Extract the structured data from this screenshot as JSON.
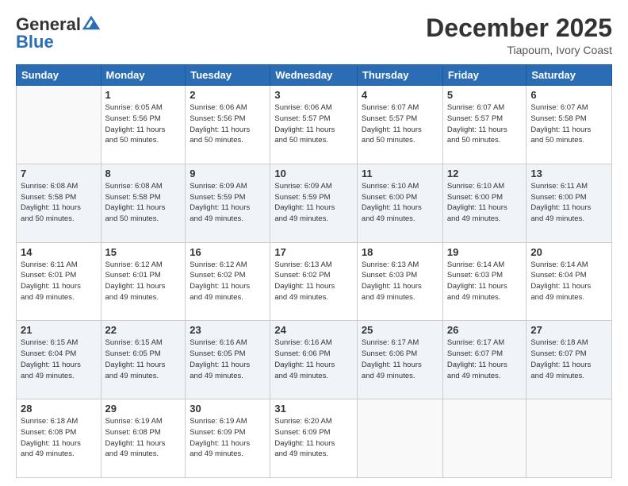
{
  "header": {
    "logo_general": "General",
    "logo_blue": "Blue",
    "month": "December 2025",
    "location": "Tiapoum, Ivory Coast"
  },
  "days_of_week": [
    "Sunday",
    "Monday",
    "Tuesday",
    "Wednesday",
    "Thursday",
    "Friday",
    "Saturday"
  ],
  "weeks": [
    [
      {
        "day": "",
        "info": ""
      },
      {
        "day": "1",
        "info": "Sunrise: 6:05 AM\nSunset: 5:56 PM\nDaylight: 11 hours\nand 50 minutes."
      },
      {
        "day": "2",
        "info": "Sunrise: 6:06 AM\nSunset: 5:56 PM\nDaylight: 11 hours\nand 50 minutes."
      },
      {
        "day": "3",
        "info": "Sunrise: 6:06 AM\nSunset: 5:57 PM\nDaylight: 11 hours\nand 50 minutes."
      },
      {
        "day": "4",
        "info": "Sunrise: 6:07 AM\nSunset: 5:57 PM\nDaylight: 11 hours\nand 50 minutes."
      },
      {
        "day": "5",
        "info": "Sunrise: 6:07 AM\nSunset: 5:57 PM\nDaylight: 11 hours\nand 50 minutes."
      },
      {
        "day": "6",
        "info": "Sunrise: 6:07 AM\nSunset: 5:58 PM\nDaylight: 11 hours\nand 50 minutes."
      }
    ],
    [
      {
        "day": "7",
        "info": "Sunrise: 6:08 AM\nSunset: 5:58 PM\nDaylight: 11 hours\nand 50 minutes."
      },
      {
        "day": "8",
        "info": "Sunrise: 6:08 AM\nSunset: 5:58 PM\nDaylight: 11 hours\nand 50 minutes."
      },
      {
        "day": "9",
        "info": "Sunrise: 6:09 AM\nSunset: 5:59 PM\nDaylight: 11 hours\nand 49 minutes."
      },
      {
        "day": "10",
        "info": "Sunrise: 6:09 AM\nSunset: 5:59 PM\nDaylight: 11 hours\nand 49 minutes."
      },
      {
        "day": "11",
        "info": "Sunrise: 6:10 AM\nSunset: 6:00 PM\nDaylight: 11 hours\nand 49 minutes."
      },
      {
        "day": "12",
        "info": "Sunrise: 6:10 AM\nSunset: 6:00 PM\nDaylight: 11 hours\nand 49 minutes."
      },
      {
        "day": "13",
        "info": "Sunrise: 6:11 AM\nSunset: 6:00 PM\nDaylight: 11 hours\nand 49 minutes."
      }
    ],
    [
      {
        "day": "14",
        "info": "Sunrise: 6:11 AM\nSunset: 6:01 PM\nDaylight: 11 hours\nand 49 minutes."
      },
      {
        "day": "15",
        "info": "Sunrise: 6:12 AM\nSunset: 6:01 PM\nDaylight: 11 hours\nand 49 minutes."
      },
      {
        "day": "16",
        "info": "Sunrise: 6:12 AM\nSunset: 6:02 PM\nDaylight: 11 hours\nand 49 minutes."
      },
      {
        "day": "17",
        "info": "Sunrise: 6:13 AM\nSunset: 6:02 PM\nDaylight: 11 hours\nand 49 minutes."
      },
      {
        "day": "18",
        "info": "Sunrise: 6:13 AM\nSunset: 6:03 PM\nDaylight: 11 hours\nand 49 minutes."
      },
      {
        "day": "19",
        "info": "Sunrise: 6:14 AM\nSunset: 6:03 PM\nDaylight: 11 hours\nand 49 minutes."
      },
      {
        "day": "20",
        "info": "Sunrise: 6:14 AM\nSunset: 6:04 PM\nDaylight: 11 hours\nand 49 minutes."
      }
    ],
    [
      {
        "day": "21",
        "info": "Sunrise: 6:15 AM\nSunset: 6:04 PM\nDaylight: 11 hours\nand 49 minutes."
      },
      {
        "day": "22",
        "info": "Sunrise: 6:15 AM\nSunset: 6:05 PM\nDaylight: 11 hours\nand 49 minutes."
      },
      {
        "day": "23",
        "info": "Sunrise: 6:16 AM\nSunset: 6:05 PM\nDaylight: 11 hours\nand 49 minutes."
      },
      {
        "day": "24",
        "info": "Sunrise: 6:16 AM\nSunset: 6:06 PM\nDaylight: 11 hours\nand 49 minutes."
      },
      {
        "day": "25",
        "info": "Sunrise: 6:17 AM\nSunset: 6:06 PM\nDaylight: 11 hours\nand 49 minutes."
      },
      {
        "day": "26",
        "info": "Sunrise: 6:17 AM\nSunset: 6:07 PM\nDaylight: 11 hours\nand 49 minutes."
      },
      {
        "day": "27",
        "info": "Sunrise: 6:18 AM\nSunset: 6:07 PM\nDaylight: 11 hours\nand 49 minutes."
      }
    ],
    [
      {
        "day": "28",
        "info": "Sunrise: 6:18 AM\nSunset: 6:08 PM\nDaylight: 11 hours\nand 49 minutes."
      },
      {
        "day": "29",
        "info": "Sunrise: 6:19 AM\nSunset: 6:08 PM\nDaylight: 11 hours\nand 49 minutes."
      },
      {
        "day": "30",
        "info": "Sunrise: 6:19 AM\nSunset: 6:09 PM\nDaylight: 11 hours\nand 49 minutes."
      },
      {
        "day": "31",
        "info": "Sunrise: 6:20 AM\nSunset: 6:09 PM\nDaylight: 11 hours\nand 49 minutes."
      },
      {
        "day": "",
        "info": ""
      },
      {
        "day": "",
        "info": ""
      },
      {
        "day": "",
        "info": ""
      }
    ]
  ]
}
